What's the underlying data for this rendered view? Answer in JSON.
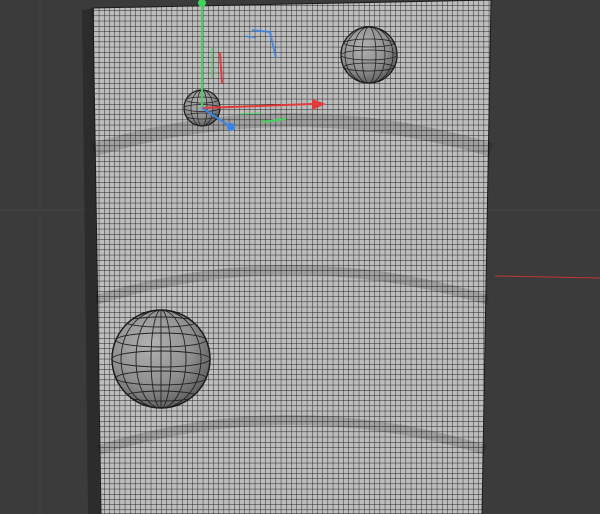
{
  "viewport": {
    "background": "#3b3b3b",
    "grid_line_color": "#222222",
    "mesh_face_color": "#b9b9b9",
    "mesh_edge_color": "#1c1c1c",
    "sphere_color": "#8c8c8c",
    "axis_colors": {
      "x": "#e23b3b",
      "y": "#3fd35b",
      "z": "#3a84e6"
    }
  },
  "scene": {
    "plane": {
      "name": "subdivided-plane",
      "has_wireframe": true
    },
    "spheres": [
      {
        "name": "sphere-small-selected",
        "selected": true
      },
      {
        "name": "sphere-top-right",
        "selected": false
      },
      {
        "name": "sphere-large-lower",
        "selected": false
      }
    ],
    "gizmo": {
      "type": "move",
      "axes": [
        "x",
        "y",
        "z"
      ]
    }
  }
}
